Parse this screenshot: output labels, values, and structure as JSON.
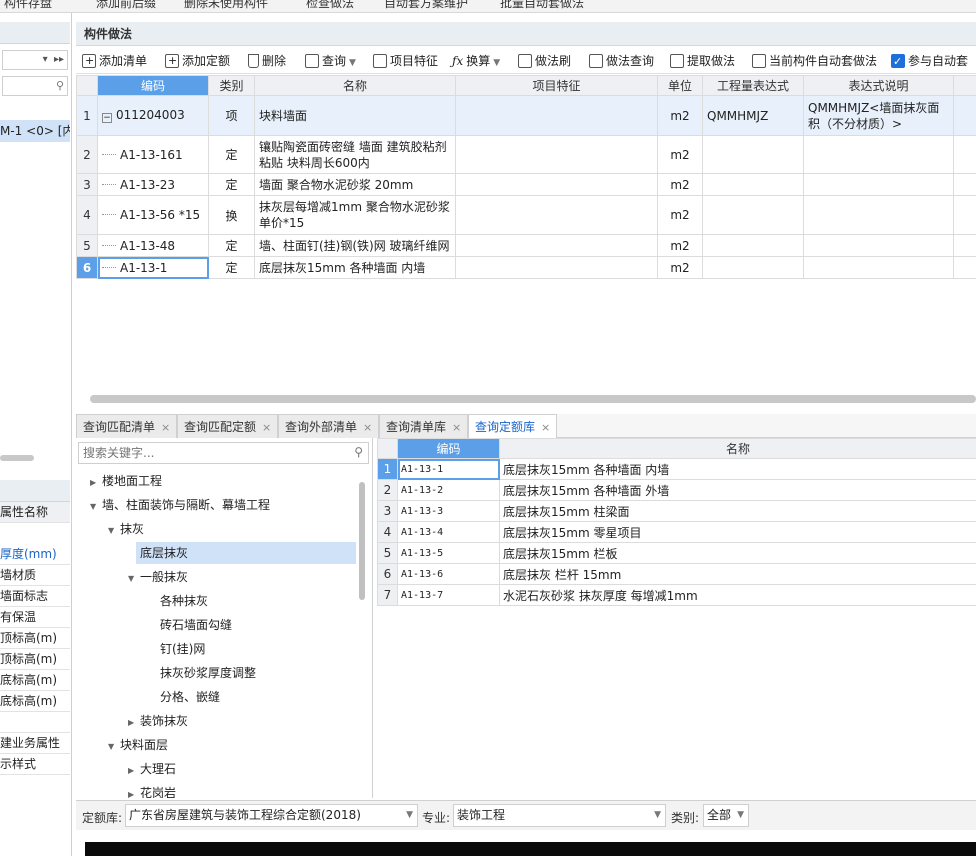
{
  "top_toolbar": [
    "构件存盘",
    "添加前后缀",
    "删除未使用构件",
    "检查做法",
    "自动套方案维护",
    "批量自动套做法"
  ],
  "left_panel": {
    "item_selected": "M-1 <0> [内",
    "props_header": "属性名称",
    "props": [
      "厚度(mm)",
      "墙材质",
      "墙面标志",
      "有保温",
      "顶标高(m)",
      "顶标高(m)",
      "底标高(m)",
      "底标高(m)",
      "",
      "建业务属性",
      "示样式"
    ]
  },
  "panel_title": "构件做法",
  "toolbar": {
    "add_list": "添加清单",
    "add_quota": "添加定额",
    "delete": "删除",
    "query": "查询",
    "item_feature": "项目特征",
    "convert": "换算",
    "method_brush": "做法刷",
    "method_query": "做法查询",
    "extract_method": "提取做法",
    "auto_method": "当前构件自动套做法",
    "auto_join": "参与自动套"
  },
  "grid": {
    "columns": [
      "编码",
      "类别",
      "名称",
      "项目特征",
      "单位",
      "工程量表达式",
      "表达式说明"
    ],
    "rows": [
      {
        "n": "1",
        "code": "011204003",
        "type": "项",
        "name": "块料墙面",
        "feature": "",
        "unit": "m2",
        "expr": "QMMHMJZ",
        "desc": "QMMHMJZ<墙面抹灰面积（不分材质）>"
      },
      {
        "n": "2",
        "code": "A1-13-161",
        "type": "定",
        "name": "镶贴陶瓷面砖密缝 墙面 建筑胶粘剂粘贴 块料周长600内",
        "feature": "",
        "unit": "m2",
        "expr": "",
        "desc": ""
      },
      {
        "n": "3",
        "code": "A1-13-23",
        "type": "定",
        "name": "墙面 聚合物水泥砂浆 20mm",
        "feature": "",
        "unit": "m2",
        "expr": "",
        "desc": ""
      },
      {
        "n": "4",
        "code": "A1-13-56 *15",
        "type": "换",
        "name": "抹灰层每增减1mm 聚合物水泥砂浆 单价*15",
        "feature": "",
        "unit": "m2",
        "expr": "",
        "desc": ""
      },
      {
        "n": "5",
        "code": "A1-13-48",
        "type": "定",
        "name": "墙、柱面钉(挂)钢(铁)网 玻璃纤维网",
        "feature": "",
        "unit": "m2",
        "expr": "",
        "desc": ""
      },
      {
        "n": "6",
        "code": "A1-13-1",
        "type": "定",
        "name": "底层抹灰15mm 各种墙面 内墙",
        "feature": "",
        "unit": "m2",
        "expr": "",
        "desc": ""
      }
    ]
  },
  "tabs": [
    "查询匹配清单",
    "查询匹配定额",
    "查询外部清单",
    "查询清单库",
    "查询定额库"
  ],
  "search_placeholder": "搜索关键字...",
  "tree": [
    {
      "label": "楼地面工程",
      "arrow": "▶"
    },
    {
      "label": "墙、柱面装饰与隔断、幕墙工程",
      "arrow": "▼"
    },
    {
      "label": "抹灰",
      "arrow": "▼"
    },
    {
      "label": "底层抹灰",
      "arrow": ""
    },
    {
      "label": "一般抹灰",
      "arrow": "▼"
    },
    {
      "label": "各种抹灰",
      "arrow": ""
    },
    {
      "label": "砖石墙面勾缝",
      "arrow": ""
    },
    {
      "label": "钉(挂)网",
      "arrow": ""
    },
    {
      "label": "抹灰砂浆厚度调整",
      "arrow": ""
    },
    {
      "label": "分格、嵌缝",
      "arrow": ""
    },
    {
      "label": "装饰抹灰",
      "arrow": "▶"
    },
    {
      "label": "块料面层",
      "arrow": "▼"
    },
    {
      "label": "大理石",
      "arrow": "▶"
    },
    {
      "label": "花岗岩",
      "arrow": "▶"
    }
  ],
  "quota_table": {
    "columns": [
      "编码",
      "名称"
    ],
    "rows": [
      {
        "n": "1",
        "code": "A1-13-1",
        "name": "底层抹灰15mm 各种墙面 内墙"
      },
      {
        "n": "2",
        "code": "A1-13-2",
        "name": "底层抹灰15mm 各种墙面 外墙"
      },
      {
        "n": "3",
        "code": "A1-13-3",
        "name": "底层抹灰15mm 柱梁面"
      },
      {
        "n": "4",
        "code": "A1-13-4",
        "name": "底层抹灰15mm 零星项目"
      },
      {
        "n": "5",
        "code": "A1-13-5",
        "name": "底层抹灰15mm 栏板"
      },
      {
        "n": "6",
        "code": "A1-13-6",
        "name": "底层抹灰 栏杆 15mm"
      },
      {
        "n": "7",
        "code": "A1-13-7",
        "name": "水泥石灰砂浆 抹灰厚度 每增减1mm"
      }
    ]
  },
  "status": {
    "library_label": "定额库:",
    "library_value": "广东省房屋建筑与装饰工程综合定额(2018)",
    "major_label": "专业:",
    "major_value": "装饰工程",
    "category_label": "类别:",
    "category_value": "全部"
  }
}
